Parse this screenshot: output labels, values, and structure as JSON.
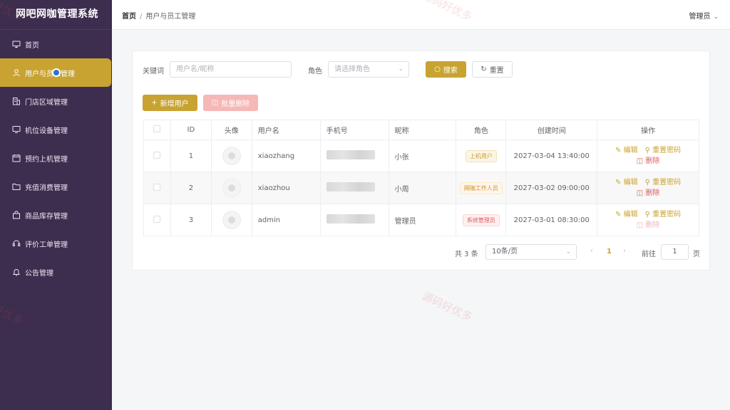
{
  "app_title": "网吧网咖管理系统",
  "sidebar": {
    "items": [
      {
        "label": "首页",
        "icon": "monitor-icon"
      },
      {
        "label": "用户与员工管理",
        "icon": "user-icon"
      },
      {
        "label": "门店区域管理",
        "icon": "building-icon"
      },
      {
        "label": "机位设备管理",
        "icon": "desktop-icon"
      },
      {
        "label": "预约上机管理",
        "icon": "calendar-icon"
      },
      {
        "label": "充值消费管理",
        "icon": "folder-icon"
      },
      {
        "label": "商品库存管理",
        "icon": "bag-icon"
      },
      {
        "label": "评价工单管理",
        "icon": "headset-icon"
      },
      {
        "label": "公告管理",
        "icon": "bell-icon"
      }
    ]
  },
  "header": {
    "breadcrumb_home": "首页",
    "breadcrumb_sep": "/",
    "breadcrumb_current": "用户与员工管理",
    "user": "管理员"
  },
  "watermark": "源码好优多",
  "filters": {
    "keyword_label": "关键词",
    "keyword_placeholder": "用户名/昵称",
    "role_label": "角色",
    "role_placeholder": "请选择角色",
    "search_label": "搜索",
    "reset_label": "重置"
  },
  "actions": {
    "add_label": "新增用户",
    "batch_delete_label": "批量删除"
  },
  "table": {
    "headers": [
      "ID",
      "头像",
      "用户名",
      "手机号",
      "昵称",
      "角色",
      "创建时间",
      "操作"
    ],
    "rows": [
      {
        "id": "1",
        "username": "xiaozhang",
        "nickname": "小张",
        "role": "上机用户",
        "created": "2027-03-04 13:40:00"
      },
      {
        "id": "2",
        "username": "xiaozhou",
        "nickname": "小周",
        "role": "网咖工作人员",
        "created": "2027-03-02 09:00:00"
      },
      {
        "id": "3",
        "username": "admin",
        "nickname": "管理员",
        "role": "系统管理员",
        "created": "2027-03-01 08:30:00"
      }
    ],
    "op_edit": "编辑",
    "op_reset_pwd": "重置密码",
    "op_delete": "删除"
  },
  "pagination": {
    "total": "共 3 条",
    "page_size": "10条/页",
    "current_page": "1",
    "goto_label": "前往",
    "goto_value": "1",
    "goto_unit": "页"
  },
  "colors": {
    "sidebar_bg": "#3d2d4e",
    "accent": "#c9a332",
    "danger": "#e05a5a"
  }
}
